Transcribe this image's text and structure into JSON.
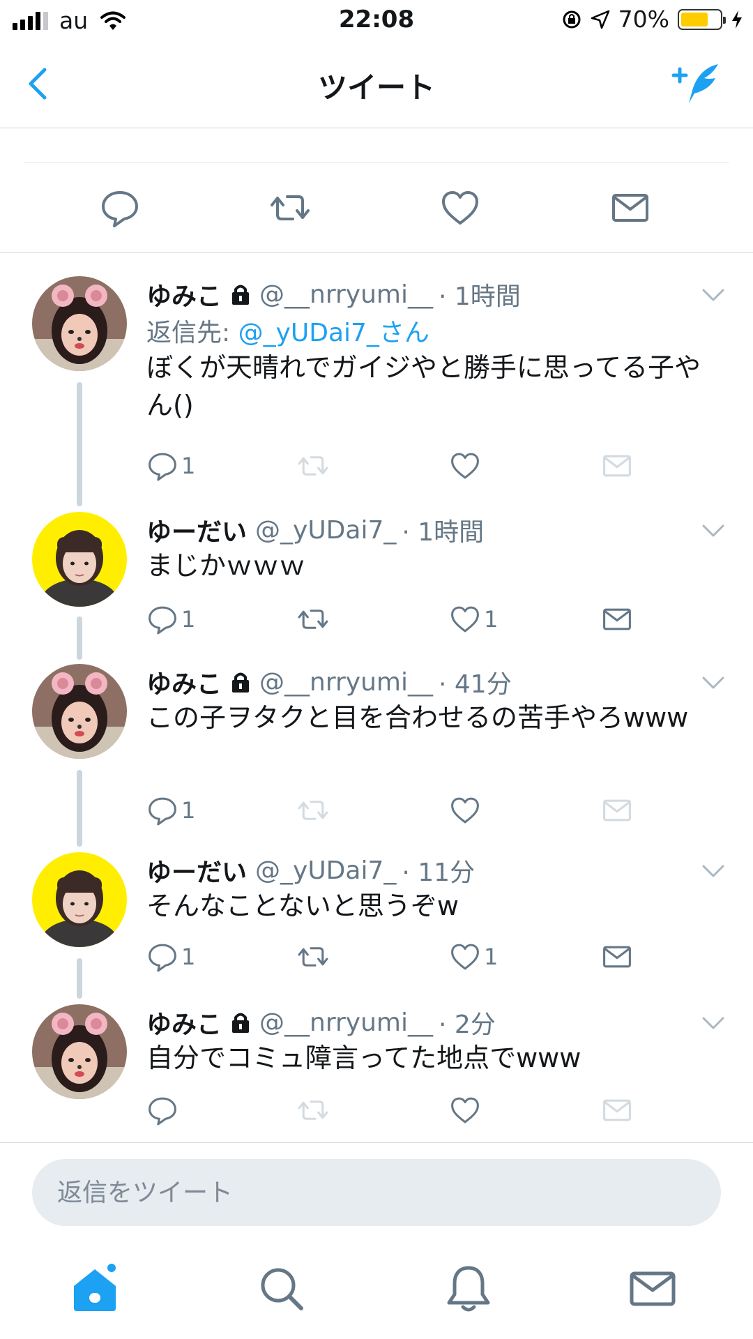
{
  "status_bar": {
    "carrier": "au",
    "time": "22:08",
    "battery": "70%"
  },
  "nav": {
    "title": "ツイート"
  },
  "colors": {
    "accent": "#1da1f2",
    "text": "#14171a",
    "muted": "#657786",
    "line": "#ccd6dd",
    "avatar_yellow": "#ffee00"
  },
  "replies": [
    {
      "name": "ゆみこ",
      "locked": true,
      "handle": "@__nrryumi__",
      "time": "· 1時間",
      "reply_to_label": "返信先: ",
      "reply_to_mention": "@_yUDai7_さん",
      "text": "ぼくが天晴れでガイジやと勝手に思ってる子やん()",
      "reply_count": "1",
      "like_count": "",
      "avatar": "cat-filter-girl"
    },
    {
      "name": "ゆーだい",
      "locked": false,
      "handle": "@_yUDai7_",
      "time": "· 1時間",
      "text": "まじかｗｗｗ",
      "reply_count": "1",
      "like_count": "1",
      "avatar": "girl-on-yellow"
    },
    {
      "name": "ゆみこ",
      "locked": true,
      "handle": "@__nrryumi__",
      "time": "· 41分",
      "text": "この子ヲタクと目を合わせるの苦手やろwww",
      "reply_count": "1",
      "like_count": "",
      "avatar": "cat-filter-girl"
    },
    {
      "name": "ゆーだい",
      "locked": false,
      "handle": "@_yUDai7_",
      "time": "· 11分",
      "text": "そんなことないと思うぞw",
      "reply_count": "1",
      "like_count": "1",
      "avatar": "girl-on-yellow"
    },
    {
      "name": "ゆみこ",
      "locked": true,
      "handle": "@__nrryumi__",
      "time": "· 2分",
      "text": "自分でコミュ障言ってた地点でwww",
      "reply_count": "",
      "like_count": "",
      "avatar": "cat-filter-girl"
    }
  ],
  "compose": {
    "placeholder": "返信をツイート"
  },
  "tabs": [
    "home-icon",
    "search-icon",
    "notifications-icon",
    "messages-icon"
  ]
}
